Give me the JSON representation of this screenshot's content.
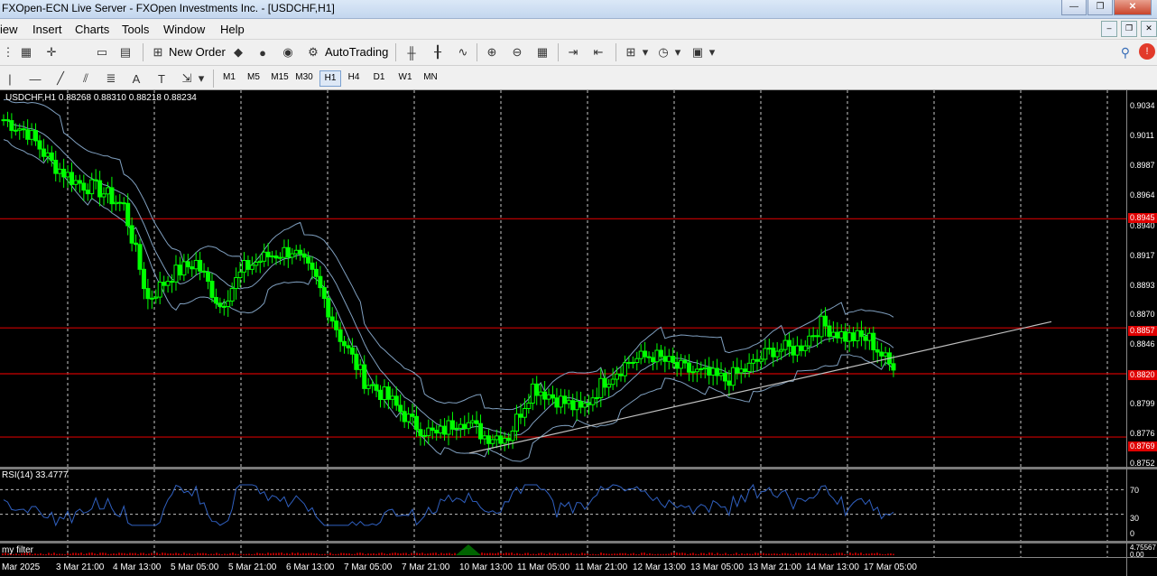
{
  "window": {
    "title": "FXOpen-ECN Live Server - FXOpen Investments Inc. - [USDCHF,H1]",
    "buttons": {
      "min": "—",
      "max": "❐",
      "close": "✕"
    }
  },
  "menu": {
    "items": [
      "iew",
      "Insert",
      "Charts",
      "Tools",
      "Window",
      "Help"
    ],
    "mdi": {
      "min": "–",
      "restore": "❐",
      "close": "✕"
    }
  },
  "toolbar": {
    "new_order": "New Order",
    "autotrading": "AutoTrading"
  },
  "toolbar2": {
    "text_tool": "A",
    "timeframes": [
      "M1",
      "M5",
      "M15",
      "M30",
      "H1",
      "H4",
      "D1",
      "W1",
      "MN"
    ],
    "active_timeframe": "H1"
  },
  "chart": {
    "symbol_label": "USDCHF,H1  0.88268 0.88310 0.88218 0.88234",
    "rsi_label": "RSI(14) 33.4777",
    "filter_label": "my filter",
    "price_labels": [
      "0.9034",
      "0.9011",
      "0.8987",
      "0.8964",
      "0.8940",
      "0.8917",
      "0.8893",
      "0.8870",
      "0.8846",
      "0.8799",
      "0.8776",
      "0.8752"
    ],
    "red_tags": [
      "0.8945",
      "0.8857",
      "0.8820",
      "0.8769"
    ],
    "rsi_scale": [
      "70",
      "30",
      "0"
    ],
    "filter_scale": [
      "4.75567",
      "0.00"
    ],
    "time_labels": [
      "Mar 2025",
      "3 Mar 21:00",
      "4 Mar 13:00",
      "5 Mar 05:00",
      "5 Mar 21:00",
      "6 Mar 13:00",
      "7 Mar 05:00",
      "7 Mar 21:00",
      "10 Mar 13:00",
      "11 Mar 05:00",
      "11 Mar 21:00",
      "12 Mar 13:00",
      "13 Mar 05:00",
      "13 Mar 21:00",
      "14 Mar 13:00",
      "17 Mar 05:00"
    ],
    "colors": {
      "candles": "#00ff00",
      "bands": "#7f9fbf",
      "levels": "#cc0000",
      "trendline": "#c0c0c0",
      "rsi": "#3060c0"
    }
  },
  "chart_data": {
    "type": "line",
    "title": "USDCHF,H1",
    "series": [
      {
        "name": "USDCHF,H1",
        "values": [
          0.9025,
          0.9015,
          0.899,
          0.8975,
          0.8968,
          0.8955,
          0.888,
          0.89,
          0.891,
          0.8875,
          0.8905,
          0.8915,
          0.892,
          0.8895,
          0.885,
          0.8815,
          0.88,
          0.878,
          0.877,
          0.8785,
          0.877,
          0.877,
          0.881,
          0.88,
          0.879,
          0.8815,
          0.883,
          0.8835,
          0.8825,
          0.882,
          0.8815,
          0.8825,
          0.884,
          0.884,
          0.886,
          0.885,
          0.8848,
          0.8823
        ]
      }
    ],
    "price_levels": [
      0.8945,
      0.8857,
      0.882,
      0.8769
    ],
    "ylim": [
      0.8745,
      0.9045
    ],
    "rsi": {
      "name": "RSI(14)",
      "last": 33.4777,
      "levels": [
        70,
        30
      ],
      "ylim": [
        0,
        100
      ]
    }
  }
}
